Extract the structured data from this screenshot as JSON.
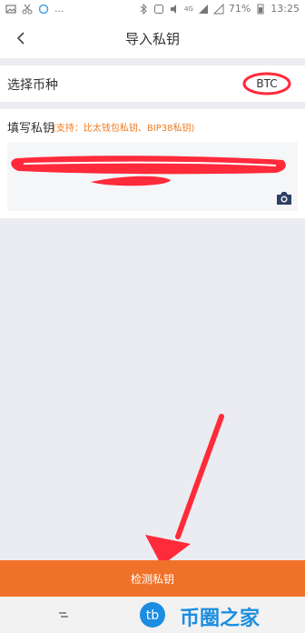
{
  "status_bar": {
    "left_dots": "...",
    "battery_percent": "71%",
    "time": "13:25",
    "network_label": "4G"
  },
  "header": {
    "title": "导入私钥"
  },
  "coin_select": {
    "label": "选择币种",
    "value": "BTC"
  },
  "private_key": {
    "label": "填写私钥",
    "hint": "(支持：比太钱包私钥、BIP38私钥)"
  },
  "detect_button": {
    "label": "检测私钥"
  },
  "watermark": {
    "logo_text": "tb",
    "text": "币圈之家"
  },
  "colors": {
    "accent": "#f0722a",
    "hint": "#f07a1e",
    "annotation_red": "#ff2a3a"
  }
}
